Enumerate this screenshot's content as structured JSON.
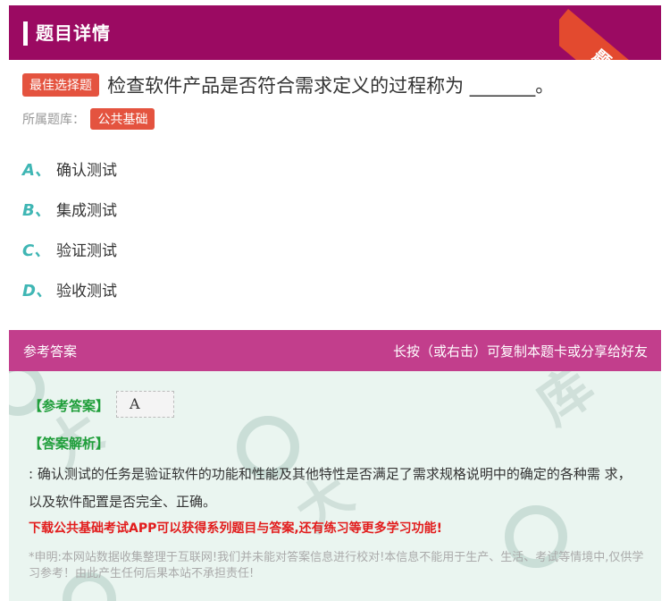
{
  "header": {
    "title": "题目详情",
    "ribbon": "题卡"
  },
  "question": {
    "type_badge": "最佳选择题",
    "text": "检查软件产品是否符合需求定义的过程称为 _______。",
    "category_label": "所属题库：",
    "category": "公共基础"
  },
  "options": [
    {
      "letter": "A、",
      "text": "确认测试"
    },
    {
      "letter": "B、",
      "text": "集成测试"
    },
    {
      "letter": "C、",
      "text": "验证测试"
    },
    {
      "letter": "D、",
      "text": "验收测试"
    }
  ],
  "answer_section": {
    "header_left": "参考答案",
    "header_right": "长按（或右击）可复制本题卡或分享给好友",
    "answer_label": "【参考答案】",
    "answer_value": "A",
    "explanation_label": "【答案解析】",
    "explanation": ": 确认测试的任务是验证软件的功能和性能及其他特性是否满足了需求规格说明中的确定的各种需 求，以及软件配置是否完全、正确。",
    "promo": "下载公共基础考试APP可以获得系列题目与答案,还有练习等更多学习功能!",
    "disclaimer": "*申明:本网站数据收集整理于互联网!我们并未能对答案信息进行校对!本信息不能用于生产、生活、考试等情境中,仅供学习参考！由此产生任何后果本站不承担责任!"
  },
  "colors": {
    "header_bg": "#9b0a62",
    "answer_header_bg": "#c23e8c",
    "badge_bg": "#e4533f",
    "option_letter": "#3fb6b4",
    "answer_label": "#1f9e3a",
    "promo": "#e21c1c"
  }
}
